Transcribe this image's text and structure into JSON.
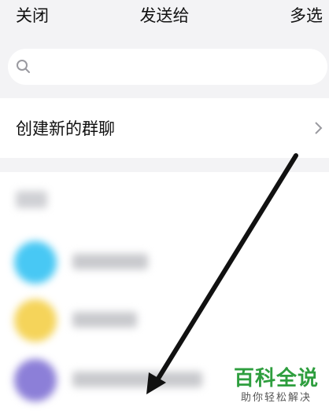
{
  "header": {
    "close_label": "关闭",
    "title": "发送给",
    "multi_select_label": "多选"
  },
  "search": {
    "icon": "search-icon",
    "placeholder": ""
  },
  "create_group": {
    "label": "创建新的群聊",
    "icon": "chevron-right-icon"
  },
  "recent_list": {
    "avatar_colors": [
      "#48c8f4",
      "#f5d45a",
      "#8c7fd8"
    ]
  },
  "watermark": {
    "main": "百科全说",
    "sub": "助你轻松解决"
  },
  "colors": {
    "background": "#f3f3f5",
    "panel": "#ffffff",
    "arrow": "#111111",
    "watermark_green": "#2e9e3e"
  }
}
